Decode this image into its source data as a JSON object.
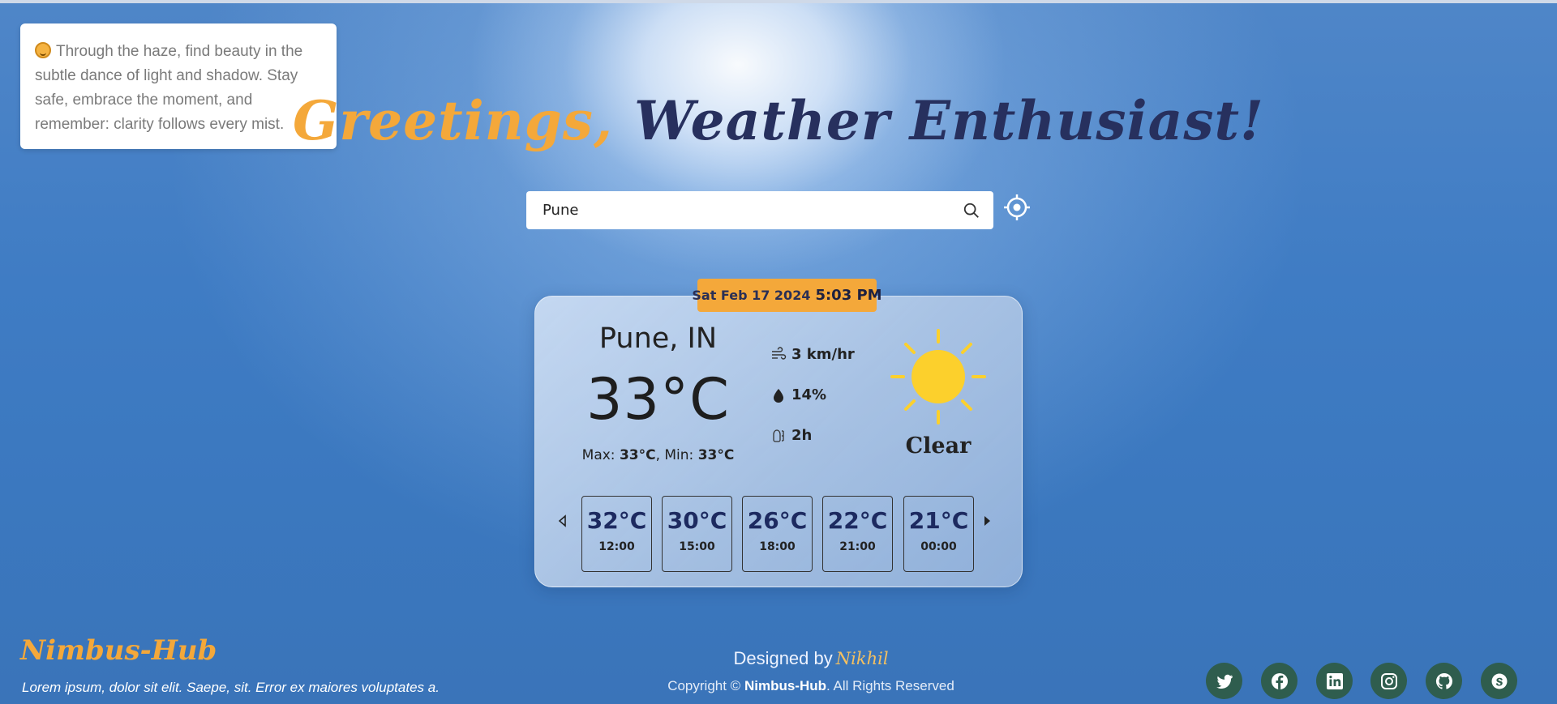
{
  "quote": {
    "text": "Through the haze, find beauty in the subtle dance of light and shadow. Stay safe, embrace the moment, and remember: clarity follows every mist."
  },
  "header": {
    "greeting": "Greetings,",
    "subtitle": "Weather Enthusiast!"
  },
  "search": {
    "value": "Pune"
  },
  "weather": {
    "date": "Sat Feb 17 2024",
    "time": "5:03 PM",
    "city": "Pune, IN",
    "temperature": "33°C",
    "max_label": "Max:",
    "max_value": "33°C",
    "min_label": "Min:",
    "min_value": "33°C",
    "wind": "3 km/hr",
    "humidity": "14%",
    "duration": "2h",
    "condition": "Clear",
    "condition_icon": "sun-icon"
  },
  "forecast": [
    {
      "temp": "32°C",
      "time": "12:00"
    },
    {
      "temp": "30°C",
      "time": "15:00"
    },
    {
      "temp": "26°C",
      "time": "18:00"
    },
    {
      "temp": "22°C",
      "time": "21:00"
    },
    {
      "temp": "21°C",
      "time": "00:00"
    }
  ],
  "footer": {
    "brand": "Nimbus-Hub",
    "tagline": "Lorem ipsum, dolor sit elit. Saepe, sit. Error ex maiores voluptates a.",
    "designed_by": "Designed by",
    "author": "Nikhil",
    "copyright_prefix": "Copyright ©",
    "copyright_brand": "Nimbus-Hub",
    "copyright_suffix": ". All Rights Reserved",
    "social_icons": [
      "twitter-icon",
      "facebook-icon",
      "linkedin-icon",
      "instagram-icon",
      "github-icon",
      "skype-icon"
    ]
  },
  "colors": {
    "accent": "#f4a83a",
    "heading_dark": "#27305e",
    "social_bg": "#2f5d4e"
  }
}
